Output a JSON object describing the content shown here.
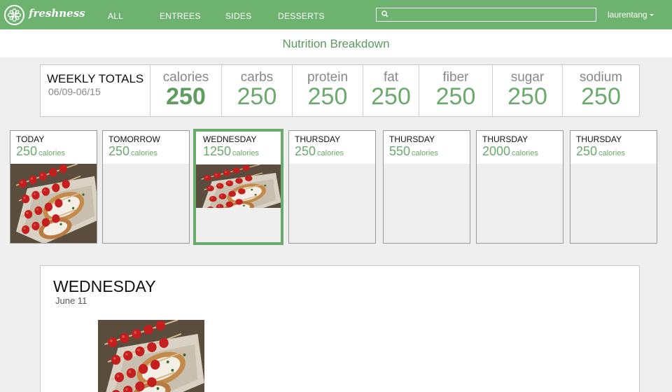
{
  "nav": {
    "brand": "freshness",
    "links": [
      "ALL",
      "ENTREES",
      "SIDES",
      "DESSERTS"
    ],
    "search_placeholder": "",
    "user": "laurentang"
  },
  "page": {
    "title": "Nutrition Breakdown"
  },
  "totals": {
    "title": "WEEKLY TOTALS",
    "range": "06/09-06/15",
    "stats": [
      {
        "label": "calories",
        "value": "250"
      },
      {
        "label": "carbs",
        "value": "250"
      },
      {
        "label": "protein",
        "value": "250"
      },
      {
        "label": "fat",
        "value": "250"
      },
      {
        "label": "fiber",
        "value": "250"
      },
      {
        "label": "sugar",
        "value": "250"
      },
      {
        "label": "sodium",
        "value": "250"
      }
    ]
  },
  "days": [
    {
      "name": "TODAY",
      "calories": "250",
      "unit": "calories",
      "has_food": true,
      "selected": false
    },
    {
      "name": "TOMORROW",
      "calories": "250",
      "unit": "calories",
      "has_food": false,
      "selected": false
    },
    {
      "name": "WEDNESDAY",
      "calories": "1250",
      "unit": "calories",
      "has_food": true,
      "selected": true
    },
    {
      "name": "THURSDAY",
      "calories": "250",
      "unit": "calories",
      "has_food": false,
      "selected": false
    },
    {
      "name": "THURSDAY",
      "calories": "550",
      "unit": "calories",
      "has_food": false,
      "selected": false
    },
    {
      "name": "THURSDAY",
      "calories": "2000",
      "unit": "calories",
      "has_food": false,
      "selected": false
    },
    {
      "name": "THURSDAY",
      "calories": "250",
      "unit": "calories",
      "has_food": false,
      "selected": false
    }
  ],
  "detail": {
    "day": "WEDNESDAY",
    "date": "June 11"
  },
  "colors": {
    "brand_green": "#6db36f",
    "accent_green": "#6aaa6c",
    "background": "#efefef"
  },
  "icons": {
    "logo": "citrus-slice-icon",
    "search": "search-icon",
    "caret": "caret-down-icon"
  }
}
